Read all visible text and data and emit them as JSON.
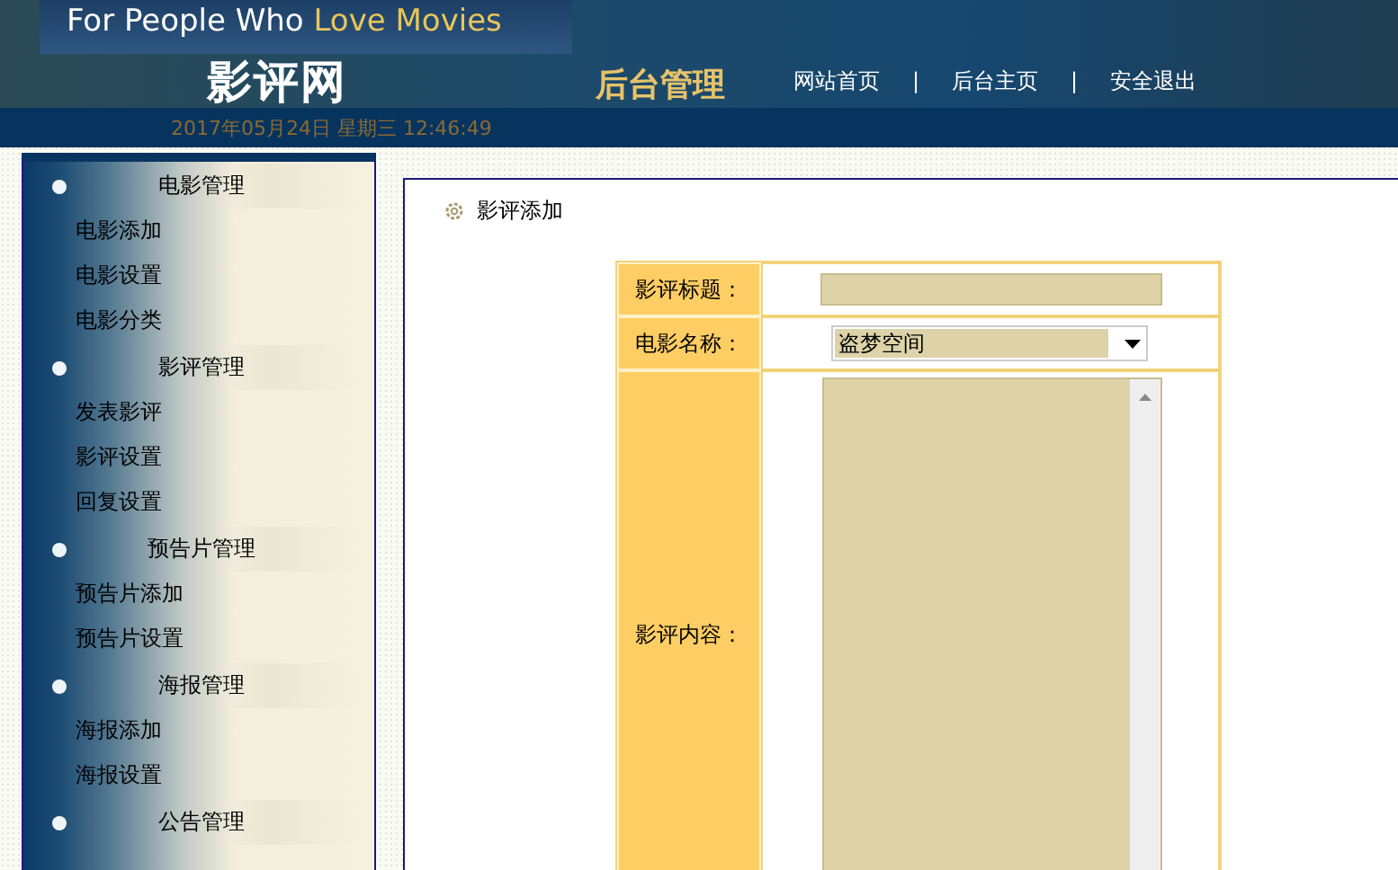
{
  "header": {
    "slogan_start": "For People Who",
    "slogan_end": "Love Movies",
    "site_title": "影评网",
    "section_title": "后台管理",
    "nav_links": [
      {
        "kind": "link",
        "label": "网站首页"
      },
      {
        "kind": "separator",
        "label": "|"
      },
      {
        "kind": "link",
        "label": "后台主页"
      },
      {
        "kind": "separator",
        "label": "|"
      },
      {
        "kind": "link",
        "label": "安全退出"
      }
    ],
    "datetime": "2017年05月24日 星期三 12:46:49"
  },
  "sidebar": {
    "groups": [
      {
        "title": "电影管理",
        "items": [
          "电影添加",
          "电影设置",
          "电影分类"
        ]
      },
      {
        "title": "影评管理",
        "items": [
          "发表影评",
          "影评设置",
          "回复设置"
        ]
      },
      {
        "title": "预告片管理",
        "items": [
          "预告片添加",
          "预告片设置"
        ]
      },
      {
        "title": "海报管理",
        "items": [
          "海报添加",
          "海报设置"
        ]
      },
      {
        "title": "公告管理"
      }
    ]
  },
  "main": {
    "title": "影评添加",
    "form": {
      "fields": [
        {
          "kind": "text",
          "label": "影评标题："
        },
        {
          "kind": "select",
          "label": "电影名称：",
          "value": "盗梦空间"
        },
        {
          "kind": "textarea",
          "label": "影评内容："
        }
      ]
    }
  }
}
